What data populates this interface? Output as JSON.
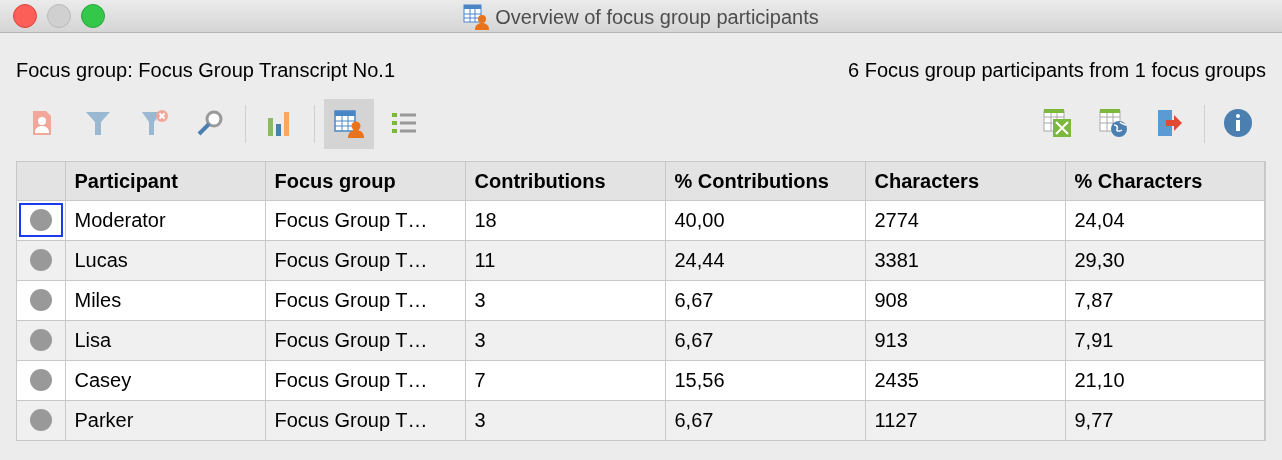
{
  "window": {
    "title": "Overview of focus group participants"
  },
  "header": {
    "focus_group": "Focus group: Focus Group Transcript No.1",
    "summary": "6 Focus group participants from 1 focus groups"
  },
  "toolbar_left": [
    {
      "kind": "participant",
      "pressed": false
    },
    {
      "kind": "filter",
      "pressed": false
    },
    {
      "kind": "unfilter",
      "pressed": false
    },
    {
      "kind": "search",
      "pressed": false
    },
    {
      "kind": "sep"
    },
    {
      "kind": "chart",
      "pressed": false
    },
    {
      "kind": "sep"
    },
    {
      "kind": "table",
      "pressed": true
    },
    {
      "kind": "list",
      "pressed": false
    }
  ],
  "toolbar_right": [
    {
      "kind": "excel",
      "pressed": false
    },
    {
      "kind": "web",
      "pressed": false
    },
    {
      "kind": "export",
      "pressed": false
    },
    {
      "kind": "sep"
    },
    {
      "kind": "info",
      "pressed": false
    }
  ],
  "table": {
    "columns": [
      "Participant",
      "Focus group",
      "Contributions",
      "% Contributions",
      "Characters",
      "% Characters"
    ],
    "rows": [
      {
        "color": "#999999",
        "selected": true,
        "cells": [
          "Moderator",
          "Focus Group T…",
          "18",
          "40,00",
          "2774",
          "24,04"
        ]
      },
      {
        "color": "#999999",
        "selected": false,
        "cells": [
          "Lucas",
          "Focus Group T…",
          "11",
          "24,44",
          "3381",
          "29,30"
        ]
      },
      {
        "color": "#999999",
        "selected": false,
        "cells": [
          "Miles",
          "Focus Group T…",
          "3",
          "6,67",
          "908",
          "7,87"
        ]
      },
      {
        "color": "#999999",
        "selected": false,
        "cells": [
          "Lisa",
          "Focus Group T…",
          "3",
          "6,67",
          "913",
          "7,91"
        ]
      },
      {
        "color": "#999999",
        "selected": false,
        "cells": [
          "Casey",
          "Focus Group T…",
          "7",
          "15,56",
          "2435",
          "21,10"
        ]
      },
      {
        "color": "#999999",
        "selected": false,
        "cells": [
          "Parker",
          "Focus Group T…",
          "3",
          "6,67",
          "1127",
          "9,77"
        ]
      }
    ]
  }
}
